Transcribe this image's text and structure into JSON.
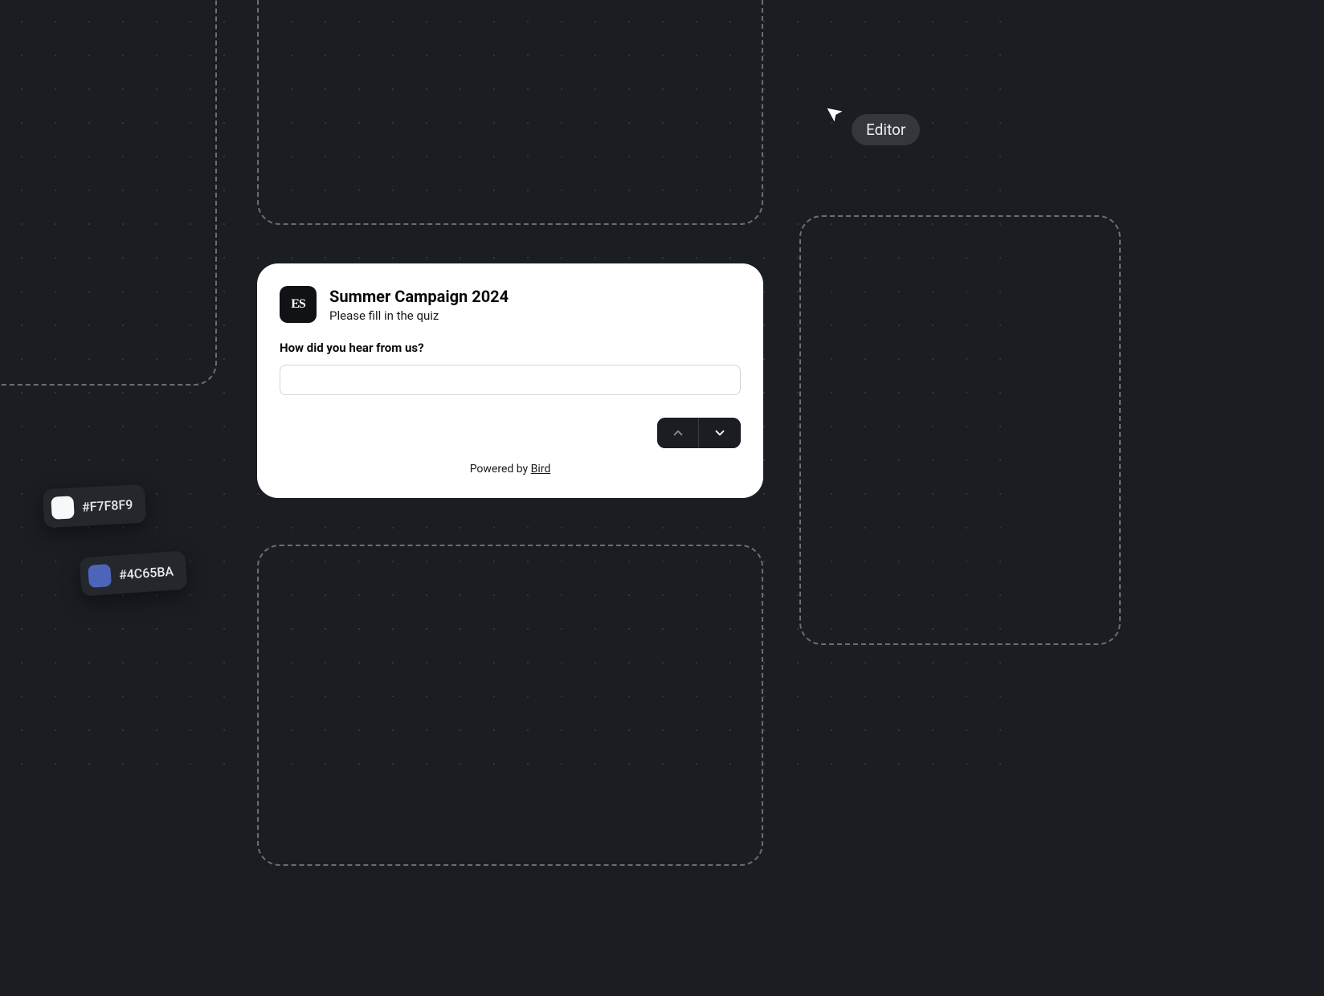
{
  "canvas": {
    "editor_badge": "Editor"
  },
  "card": {
    "logo_text": "ES",
    "title": "Summer Campaign 2024",
    "subtitle": "Please fill in the quiz",
    "question": "How did you hear from us?",
    "input_value": "",
    "input_placeholder": "",
    "powered_prefix": "Powered by ",
    "powered_brand": "Bird"
  },
  "color_chips": [
    {
      "hex": "#F7F8F9",
      "swatch": "#F7F8F9"
    },
    {
      "hex": "#4C65BA",
      "swatch": "#4C65BA"
    }
  ]
}
